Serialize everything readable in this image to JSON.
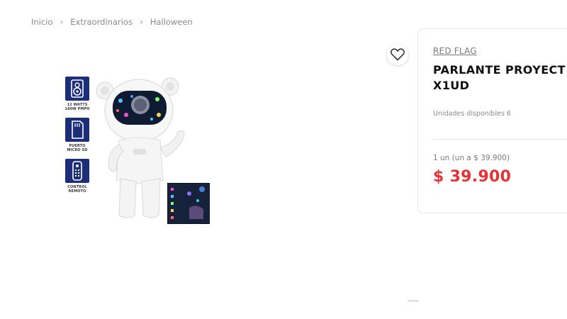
{
  "breadcrumb": {
    "items": [
      "Inicio",
      "Extraordinarios",
      "Halloween"
    ]
  },
  "product": {
    "brand": "RED FLAG",
    "title": "PARLANTE PROYECT\nX1UD",
    "stock": "Unidades disponibles 6",
    "unit_price": "1 un (un a $ 39.900)",
    "price": "$ 39.900"
  },
  "features": [
    {
      "icon": "speaker-icon",
      "caption": "12 WATTS\n180W PMPO"
    },
    {
      "icon": "micro-sd-icon",
      "caption": "PUERTO\nMICRO SD"
    },
    {
      "icon": "remote-control-icon",
      "caption": "CONTROL\nREMOTO"
    }
  ],
  "colors": {
    "price": "#e53238",
    "badge": "#1c2e78",
    "text_dark": "#111111",
    "text_muted": "#8a8a8a"
  }
}
